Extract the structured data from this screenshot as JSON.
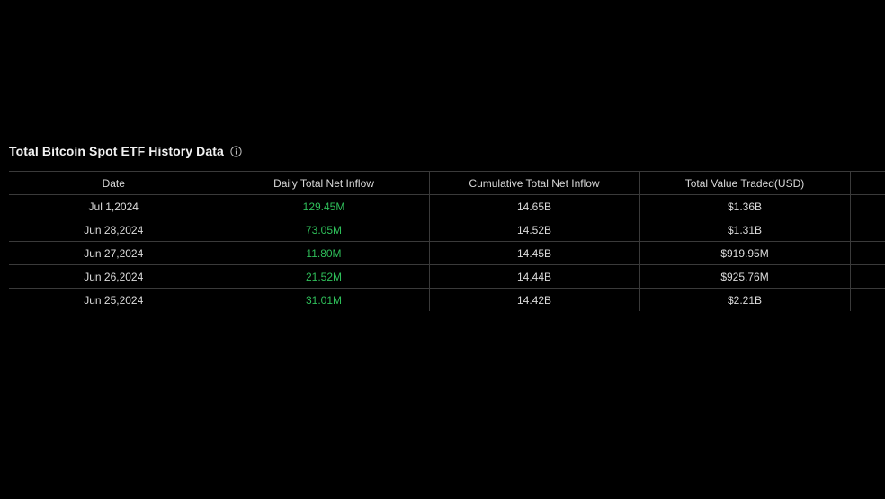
{
  "section": {
    "title": "Total Bitcoin Spot ETF History Data",
    "info_icon": "info-circle-icon"
  },
  "table": {
    "headers": [
      "Date",
      "Daily Total Net Inflow",
      "Cumulative Total Net Inflow",
      "Total Value Traded(USD)",
      ""
    ],
    "rows": [
      {
        "date": "Jul 1,2024",
        "daily": "129.45M",
        "cumulative": "14.65B",
        "traded": "$1.36B"
      },
      {
        "date": "Jun 28,2024",
        "daily": "73.05M",
        "cumulative": "14.52B",
        "traded": "$1.31B"
      },
      {
        "date": "Jun 27,2024",
        "daily": "11.80M",
        "cumulative": "14.45B",
        "traded": "$919.95M"
      },
      {
        "date": "Jun 26,2024",
        "daily": "21.52M",
        "cumulative": "14.44B",
        "traded": "$925.76M"
      },
      {
        "date": "Jun 25,2024",
        "daily": "31.01M",
        "cumulative": "14.42B",
        "traded": "$2.21B"
      }
    ]
  },
  "colors": {
    "background": "#000000",
    "positive": "#2fbf5a",
    "border": "#3a3a3a",
    "text": "#dcdcdc"
  }
}
